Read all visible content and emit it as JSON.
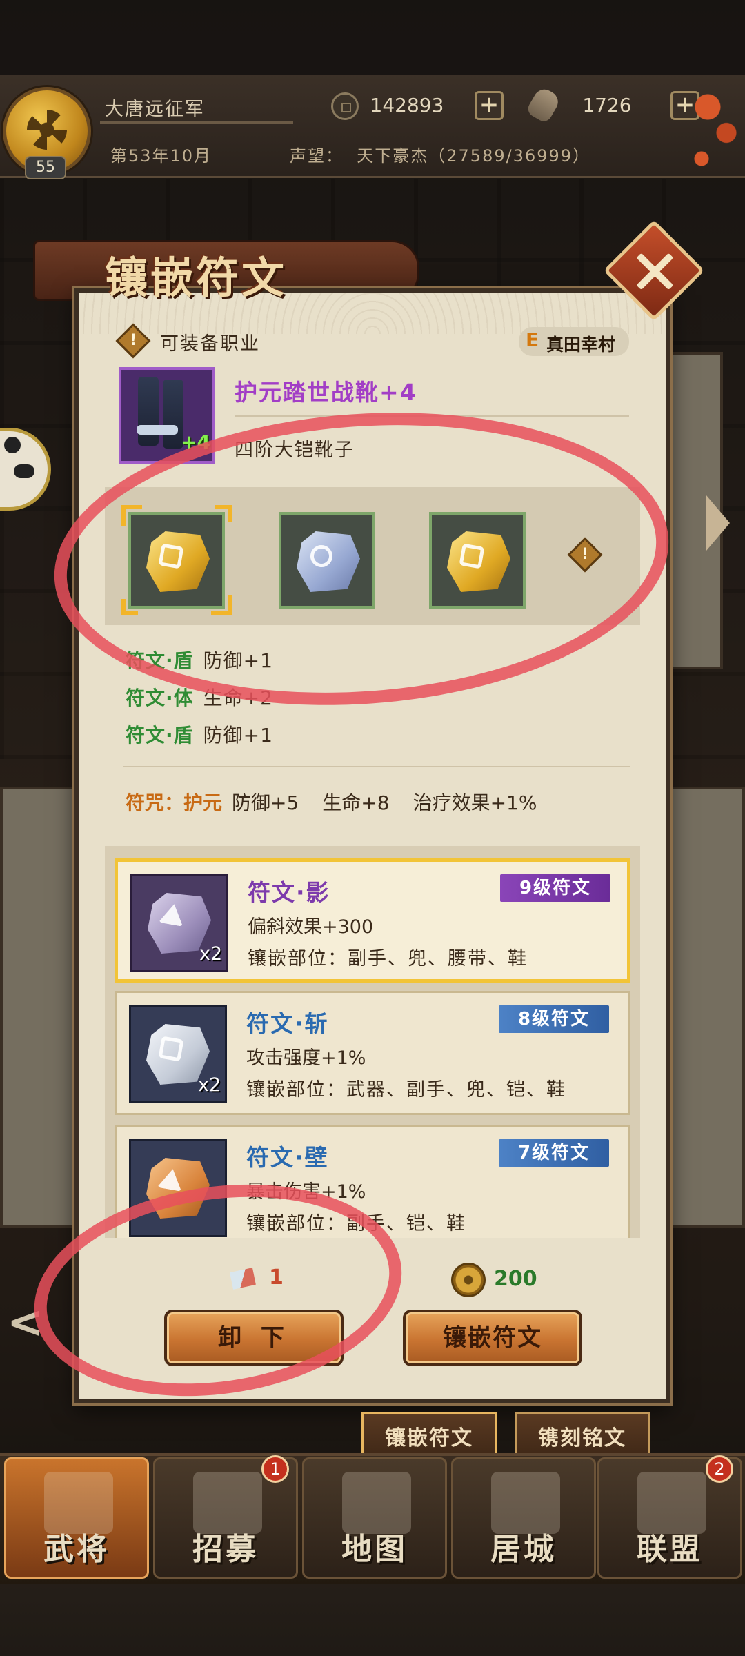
{
  "header": {
    "army_name": "大唐远征军",
    "level": "55",
    "date": "第53年10月",
    "coins": "142893",
    "rations": "1726",
    "fame_label": "声望：",
    "fame_value": "天下豪杰（27589/36999）"
  },
  "modal": {
    "title": "镶嵌符文",
    "job_label": "可装备职业",
    "hero_grade": "E",
    "hero_name": "真田幸村",
    "item": {
      "name": "护元踏世战靴+4",
      "plus": "+4",
      "type": "四阶大铠靴子"
    },
    "sockets": [
      {
        "color": "gold",
        "selected": true
      },
      {
        "color": "blue",
        "selected": false
      },
      {
        "color": "gold",
        "selected": false
      }
    ],
    "socket_info_icon": "!",
    "rune_stats": [
      {
        "key": "符文·盾",
        "value": "防御+1"
      },
      {
        "key": "符文·体",
        "value": "生命+2"
      },
      {
        "key": "符文·盾",
        "value": "防御+1"
      }
    ],
    "curse": {
      "key": "符咒：护元",
      "v1": "防御+5",
      "v2": "生命+8",
      "v3": "治疗效果+1%"
    },
    "runes": [
      {
        "name": "符文·影",
        "tier": "9级符文",
        "effect": "偏斜效果+300",
        "slots": "镶嵌部位：副手、兜、腰带、鞋",
        "count": "x2"
      },
      {
        "name": "符文·斩",
        "tier": "8级符文",
        "effect": "攻击强度+1%",
        "slots": "镶嵌部位：武器、副手、兜、铠、鞋",
        "count": "x2"
      },
      {
        "name": "符文·壁",
        "tier": "7级符文",
        "effect": "暴击伤害+1%",
        "slots": "镶嵌部位：副手、铠、鞋",
        "count": ""
      }
    ],
    "shard_count": "1",
    "coin_cost": "200",
    "unload_label": "卸 下",
    "inlay_label": "镶嵌符文"
  },
  "subtabs": {
    "inlay": "镶嵌符文",
    "engrave": "镌刻铭文"
  },
  "nav": [
    {
      "label": "武将",
      "badge": ""
    },
    {
      "label": "招募",
      "badge": "1"
    },
    {
      "label": "地图",
      "badge": ""
    },
    {
      "label": "居城",
      "badge": ""
    },
    {
      "label": "联盟",
      "badge": "2"
    }
  ],
  "colors": {
    "annotation": "#e8505c",
    "accent": "#c97431",
    "purple_rune": "#7d3aac",
    "blue_rune": "#2a6ab0"
  }
}
